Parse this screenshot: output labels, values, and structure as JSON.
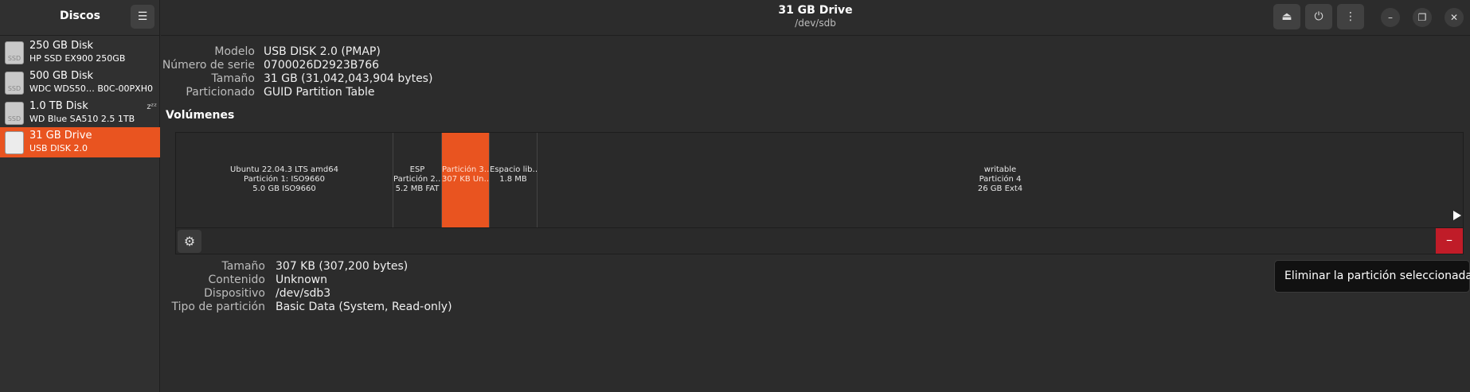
{
  "sidebar": {
    "title": "Discos",
    "menu_icon": "hamburger-menu-icon",
    "disks": [
      {
        "name": "250 GB Disk",
        "sub": "HP SSD EX900 250GB",
        "icon_label": "SSD"
      },
      {
        "name": "500 GB Disk",
        "sub": "WDC WDS50…   B0C-00PXH0",
        "icon_label": "SSD"
      },
      {
        "name": "1.0 TB Disk",
        "sub": "WD Blue SA510 2.5 1TB",
        "icon_label": "SSD",
        "sleep": "zᶻᶻ"
      },
      {
        "name": "31 GB Drive",
        "sub": "USB DISK 2.0",
        "icon_label": "",
        "selected": true
      }
    ]
  },
  "header": {
    "title": "31 GB Drive",
    "subtitle": "/dev/sdb",
    "buttons": {
      "eject": "⏏",
      "power": "⏻",
      "more": "⋮"
    },
    "window": {
      "minimize": "–",
      "restore": "❐",
      "close": "✕"
    }
  },
  "drive_info": {
    "model_label": "Modelo",
    "model": "USB DISK 2.0 (PMAP)",
    "serial_label": "Número de serie",
    "serial": "0700026D2923B766",
    "size_label": "Tamaño",
    "size": "31 GB (31,042,043,904 bytes)",
    "partitioning_label": "Particionado",
    "partitioning": "GUID Partition Table"
  },
  "volumes_title": "Volúmenes",
  "partitions": [
    {
      "line1": "Ubuntu 22.04.3 LTS amd64",
      "line2": "Partición 1: ISO9660",
      "line3": "5.0 GB ISO9660"
    },
    {
      "line1": "ESP",
      "line2": "Partición 2…",
      "line3": "5.2 MB FAT"
    },
    {
      "line1": "Partición 3…",
      "line2": "307 KB Un…",
      "line3": "",
      "selected": true
    },
    {
      "line1": "Espacio lib…",
      "line2": "1.8 MB",
      "line3": ""
    },
    {
      "line1": "writable",
      "line2": "Partición 4",
      "line3": "26 GB Ext4"
    }
  ],
  "volume_toolbar": {
    "settings_icon": "⚙",
    "delete_icon": "–"
  },
  "partition_info": {
    "size_label": "Tamaño",
    "size": "307 KB (307,200 bytes)",
    "content_label": "Contenido",
    "content": "Unknown",
    "device_label": "Dispositivo",
    "device": "/dev/sdb3",
    "type_label": "Tipo de partición",
    "type": "Basic Data (System, Read-only)"
  },
  "tooltip": "Eliminar la partición seleccionada",
  "colors": {
    "accent": "#e95420",
    "danger": "#c01c28"
  }
}
